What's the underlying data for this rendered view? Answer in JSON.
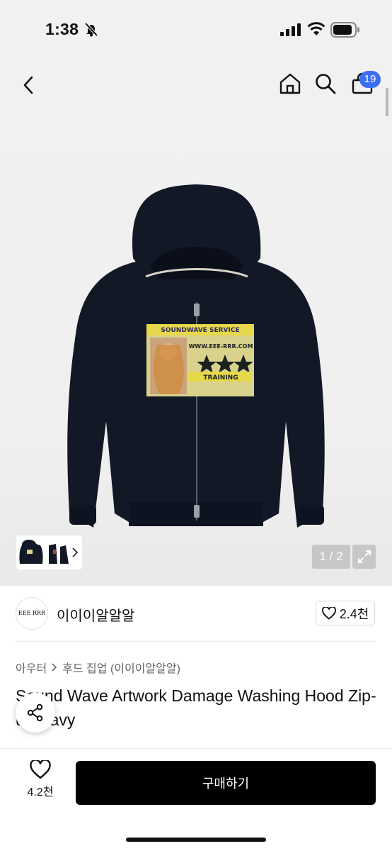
{
  "status_bar": {
    "time": "1:38"
  },
  "nav": {
    "cart_count": "19"
  },
  "gallery": {
    "pager": "1 / 2"
  },
  "brand": {
    "logo_text": "EEE RRR",
    "name": "이이이알알알"
  },
  "likes": {
    "count": "2.4천"
  },
  "breadcrumb": {
    "category": "아우터",
    "subcategory": "후드 집업 (이이이알알알)"
  },
  "product": {
    "title": "Sound Wave Artwork Damage Washing Hood Zip-up Navy"
  },
  "artwork": {
    "line1": "SOUNDWAVE SERVICE",
    "line2": "WWW.EEE-RRR.COM",
    "line3": "TRAINING"
  },
  "bottom": {
    "wish_count": "4.2천",
    "buy_label": "구매하기"
  },
  "colors": {
    "accent": "#3b6ef0",
    "hoodie": "#121826",
    "buy": "#000000"
  }
}
